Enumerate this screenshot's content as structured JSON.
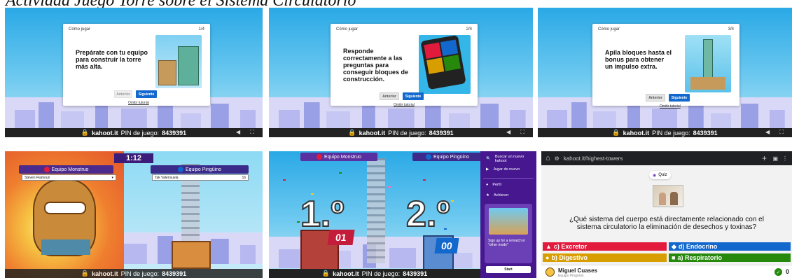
{
  "title": "Actividad Juego Torre sobre el Sistema Circulatorio",
  "pin_label": "PIN de juego:",
  "pin": "8439391",
  "site": "kahoot.it",
  "tutorial": {
    "header": "Cómo jugar",
    "prev_label": "Anterior",
    "next_label": "Siguiente",
    "skip_label": "Omitir tutorial",
    "slides": [
      {
        "counter": "1/4",
        "text": "Prepárate con tu equipo para construir la torre más alta."
      },
      {
        "counter": "2/4",
        "text": "Responde correctamente a las preguntas para conseguir bloques de construcción."
      },
      {
        "counter": "3/4",
        "text": "Apila bloques hasta el bonus para obtener un impulso extra."
      }
    ]
  },
  "game": {
    "timer": "1:12",
    "team_a": "Equipo Monstruo",
    "team_b": "Equipo Pingüino",
    "player_a": "Steven Flamoun",
    "player_b": "Tak Valensuela",
    "score_b": "16",
    "first_place": "1.º",
    "second_place": "2.º",
    "badge_a": "01",
    "badge_b": "00"
  },
  "sidebar": {
    "search_label": "Buscar un nuevo kahoot",
    "join_label": "Jugar de nuevo",
    "profile_label": "Perfil",
    "achievements_label": "Achiever",
    "promo_text": "Sign up for a rematch in \"other mode\"",
    "start_label": "Start"
  },
  "browser": {
    "url": "kahoot.it/highest-towers",
    "quiz_badge": "Quiz",
    "question": "¿Qué sistema del cuerpo está directamente relacionado con el sistema circulatorio la eliminación de desechos y toxinas?",
    "answers": [
      {
        "label": "c) Excretor",
        "color": "#e21b3c",
        "shape": "▲"
      },
      {
        "label": "d) Endocrino",
        "color": "#1368ce",
        "shape": "◆"
      },
      {
        "label": "b) Digestivo",
        "color": "#d89e00",
        "shape": "●"
      },
      {
        "label": "a) Respiratorio",
        "color": "#26890c",
        "shape": "■"
      }
    ],
    "player_name": "Miguel Cuases",
    "player_sub": "Equipo Pingüino",
    "score": "0"
  },
  "colors": {
    "kahoot_purple": "#46178f",
    "kahoot_blue": "#1368ce",
    "team_a": "#5a2f9f",
    "team_b": "#3d2a8a"
  }
}
